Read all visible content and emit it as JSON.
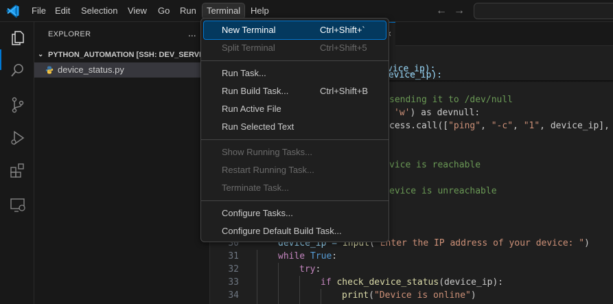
{
  "menubar": {
    "items": [
      "File",
      "Edit",
      "Selection",
      "View",
      "Go",
      "Run",
      "Terminal",
      "Help"
    ]
  },
  "explorer": {
    "title": "EXPLORER",
    "more": "...",
    "folder": "PYTHON_AUTOMATION [SSH: DEV_SERVER]",
    "file": "device_status.py"
  },
  "terminal_menu": {
    "new_terminal": {
      "label": "New Terminal",
      "shortcut": "Ctrl+Shift+`"
    },
    "split_terminal": {
      "label": "Split Terminal",
      "shortcut": "Ctrl+Shift+5"
    },
    "run_task": {
      "label": "Run Task..."
    },
    "run_build_task": {
      "label": "Run Build Task...",
      "shortcut": "Ctrl+Shift+B"
    },
    "run_active_file": {
      "label": "Run Active File"
    },
    "run_selected_text": {
      "label": "Run Selected Text"
    },
    "show_running_tasks": {
      "label": "Show Running Tasks..."
    },
    "restart_running_task": {
      "label": "Restart Running Task..."
    },
    "terminate_task": {
      "label": "Terminate Task..."
    },
    "configure_tasks": {
      "label": "Configure Tasks..."
    },
    "configure_default_build_task": {
      "label": "Configure Default Build Task..."
    }
  },
  "code": {
    "sticky1": "vice_ip):",
    "sticky2": "device_ip):",
    "c1": "sending it to /dev/null",
    "c2a": "'w'",
    "c2b": ") as devnull:",
    "c3a": "cess.call([",
    "c3b": "\"ping\"",
    "c3c": ", ",
    "c3d": "\"-c\"",
    "c3e": ", ",
    "c3f": "\"1\"",
    "c3g": ", device_ip], s",
    "c4": "vice is reachable",
    "c5": "evice is unreachable",
    "lines": [
      {
        "n": "30",
        "a": "device_ip = ",
        "b": "input",
        "c": "(",
        "d": "\"Enter the IP address of your device: \"",
        "e": ")"
      },
      {
        "n": "31",
        "a": "while",
        "b": " True",
        "c": ":"
      },
      {
        "n": "32",
        "a": "try",
        "b": ":"
      },
      {
        "n": "33",
        "a": "if",
        "b": " check_device_status",
        "c": "(device_ip):"
      },
      {
        "n": "34",
        "a": "print",
        "b": "(",
        "c": "\"Device is online\"",
        "d": ")"
      }
    ]
  },
  "colors": {
    "accent": "#0078d4",
    "menu_highlight": "#04395e"
  }
}
